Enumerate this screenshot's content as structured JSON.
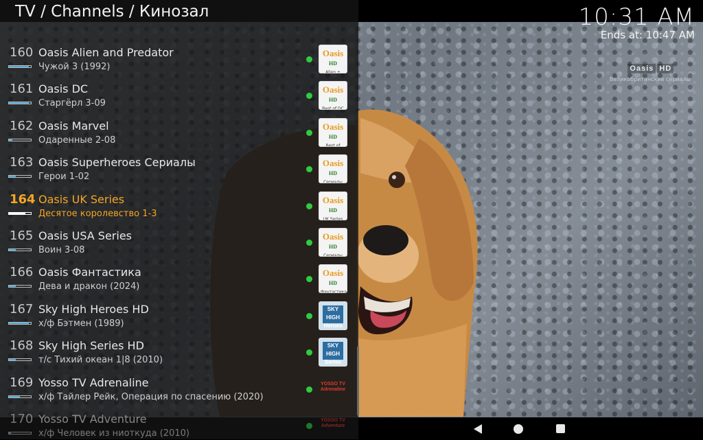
{
  "header": {
    "breadcrumb": "TV / Channels / Кинозал",
    "clock": "10:31 AM",
    "ends_at": "Ends at: 10:47 AM"
  },
  "player": {
    "channel_logo_brand": "Oasis",
    "channel_logo_badge": "HD",
    "channel_logo_sub": "Великобританские сериалы"
  },
  "channels": [
    {
      "number": "160",
      "name": "Oasis Alien and Predator",
      "program": "Чужой 3 (1992)",
      "progress": 0.9,
      "logo": {
        "kind": "oasis",
        "brand": "Oasis",
        "badge": "HD",
        "caption": "Alien + Predator"
      }
    },
    {
      "number": "161",
      "name": "Oasis DC",
      "program": "Старгёрл 3-09",
      "progress": 0.9,
      "logo": {
        "kind": "oasis",
        "brand": "Oasis",
        "badge": "HD",
        "caption": "Best of DC"
      }
    },
    {
      "number": "162",
      "name": "Oasis Marvel",
      "program": "Одаренные 2-08",
      "progress": 0.15,
      "logo": {
        "kind": "oasis",
        "brand": "Oasis",
        "badge": "HD",
        "caption": "Best of Marvel"
      }
    },
    {
      "number": "163",
      "name": "Oasis Superheroes Сериалы",
      "program": "Герои 1-02",
      "progress": 0.3,
      "logo": {
        "kind": "oasis",
        "brand": "Oasis",
        "badge": "HD",
        "caption": "Сериалы"
      }
    },
    {
      "number": "164",
      "name": "Oasis UK Series",
      "program": "Десятое королевство 1-3",
      "progress": 0.75,
      "selected": true,
      "logo": {
        "kind": "oasis",
        "brand": "Oasis",
        "badge": "HD",
        "caption": "UK Series"
      }
    },
    {
      "number": "165",
      "name": "Oasis USA Series",
      "program": "Воин 3-08",
      "progress": 0.3,
      "logo": {
        "kind": "oasis",
        "brand": "Oasis",
        "badge": "HD",
        "caption": "Сериалы"
      }
    },
    {
      "number": "166",
      "name": "Oasis Фантастика",
      "program": "Дева и дракон (2024)",
      "progress": 0.3,
      "logo": {
        "kind": "oasis",
        "brand": "Oasis",
        "badge": "HD",
        "caption": "Фантастика"
      }
    },
    {
      "number": "167",
      "name": "Sky High Heroes HD",
      "program": "х/ф Бэтмен (1989)",
      "progress": 0.9,
      "logo": {
        "kind": "sky",
        "brand": "SKY HIGH",
        "caption": "Heroes"
      }
    },
    {
      "number": "168",
      "name": "Sky High Series HD",
      "program": "т/с Тихий океан 1|8 (2010)",
      "progress": 0.3,
      "logo": {
        "kind": "sky",
        "brand": "SKY HIGH",
        "caption": "Series"
      }
    },
    {
      "number": "169",
      "name": "Yosso TV Adrenaline",
      "program": "х/ф Тайлер Рейк, Операция по спасению (2020)",
      "progress": 0.5,
      "logo": {
        "kind": "yosso",
        "brand": "YOSSO TV",
        "caption": "Adrenaline"
      }
    },
    {
      "number": "170",
      "name": "Yosso TV Adventure",
      "program": "х/ф Человек из ниоткуда (2010)",
      "progress": 0.1,
      "faded": true,
      "logo": {
        "kind": "yosso",
        "brand": "YOSSO TV",
        "caption": "Adventure"
      }
    }
  ],
  "colors": {
    "selected": "#f6a623",
    "online_dot": "#2ecc40",
    "progress_fill": "#4aa3d8"
  },
  "navbar": {
    "back_icon": "back-triangle-icon",
    "home_icon": "home-circle-icon",
    "recents_icon": "recents-square-icon"
  }
}
